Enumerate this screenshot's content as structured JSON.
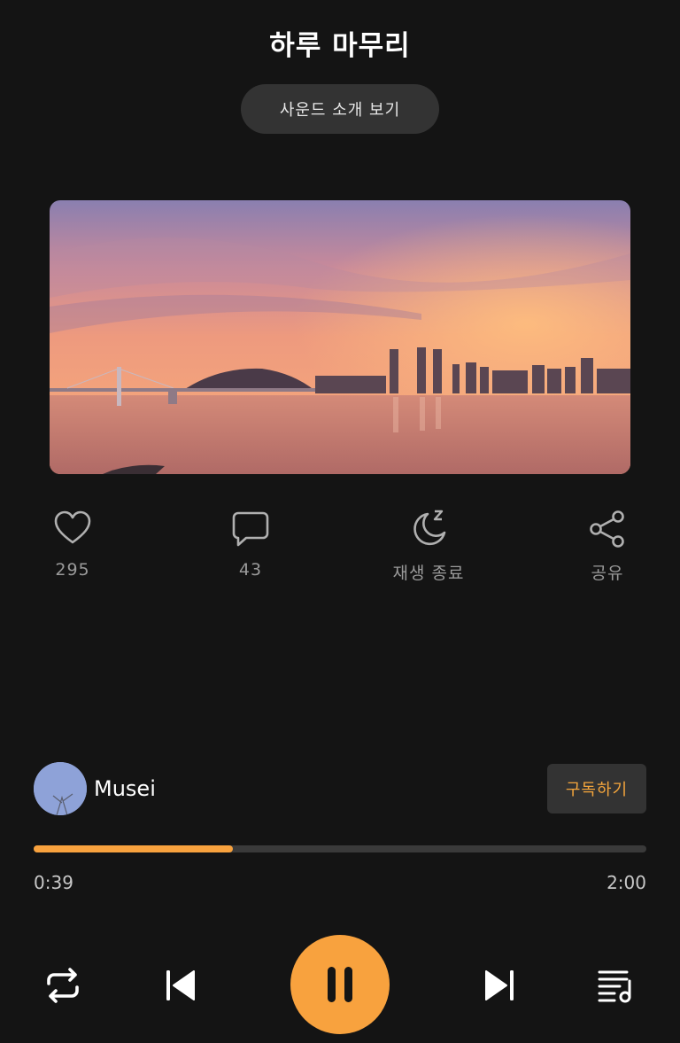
{
  "header": {
    "title": "하루 마무리",
    "intro_button": "사운드 소개 보기"
  },
  "actions": {
    "like": {
      "count": "295",
      "icon": "heart-icon"
    },
    "comment": {
      "count": "43",
      "icon": "comment-icon"
    },
    "sleep_timer": {
      "label": "재생 종료",
      "icon": "moon-sleep-icon"
    },
    "share": {
      "label": "공유",
      "icon": "share-icon"
    }
  },
  "creator": {
    "name": "Musei",
    "subscribe_label": "구독하기"
  },
  "player": {
    "current_time": "0:39",
    "total_time": "2:00",
    "progress": 0.325,
    "state": "playing"
  },
  "colors": {
    "accent": "#f8a23e",
    "background": "#141414",
    "surface": "#333333"
  }
}
